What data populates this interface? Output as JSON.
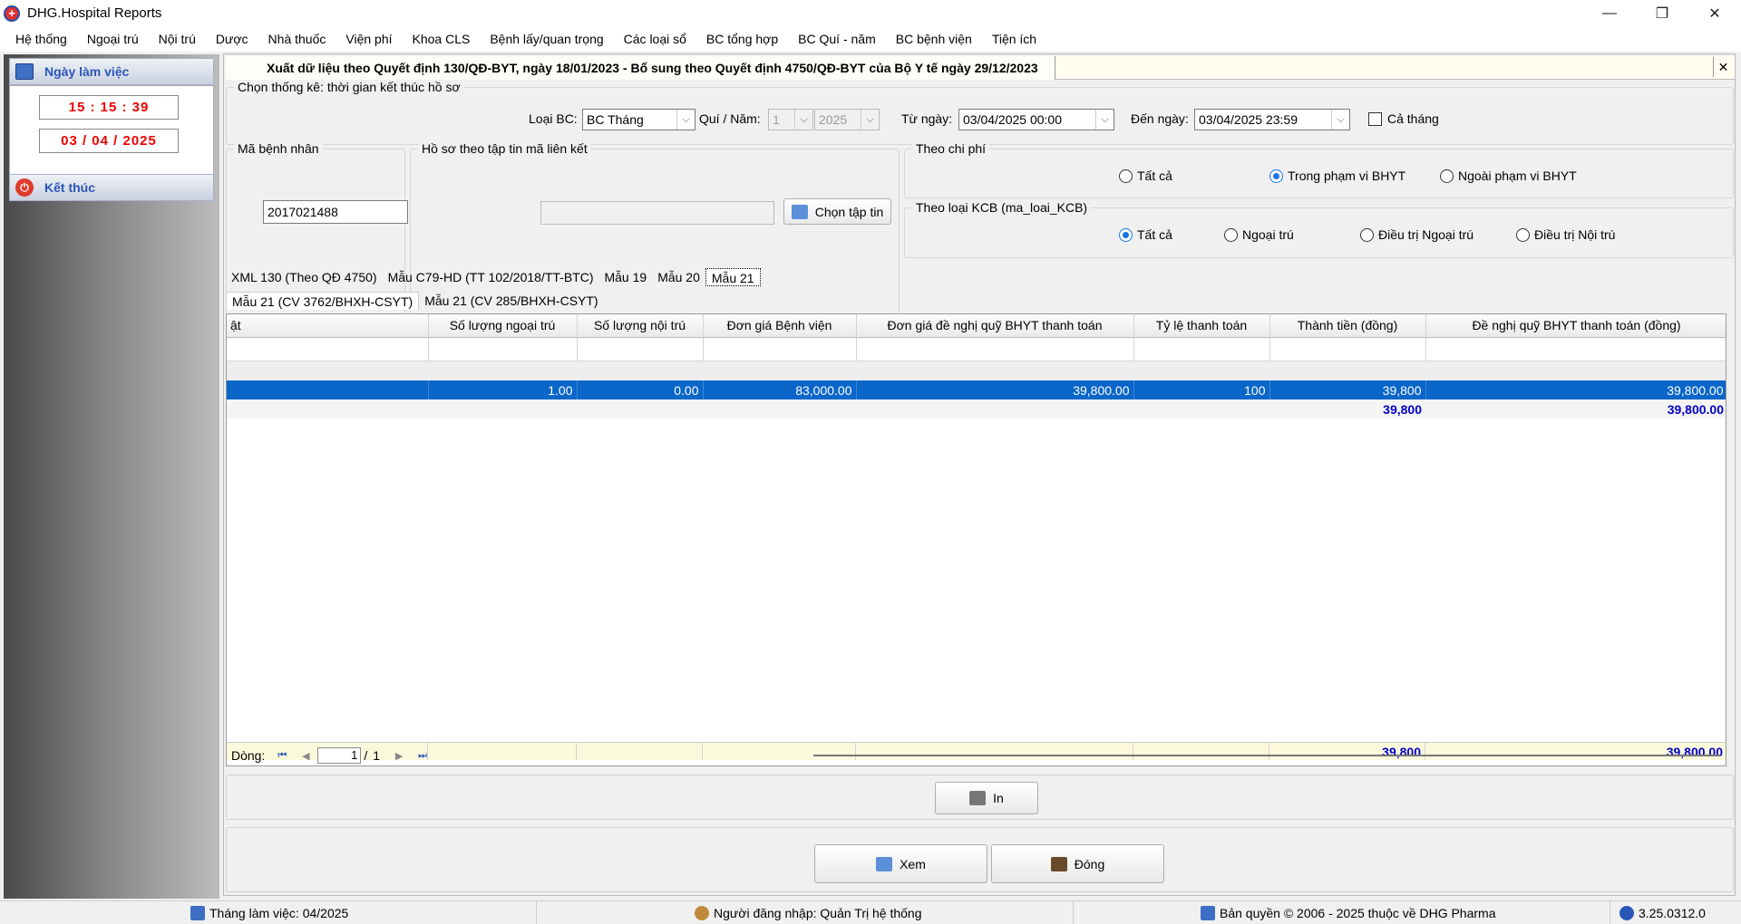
{
  "window": {
    "title": "DHG.Hospital Reports"
  },
  "menu": [
    "Hệ thống",
    "Ngoại trú",
    "Nội trú",
    "Dược",
    "Nhà thuốc",
    "Viện phí",
    "Khoa CLS",
    "Bệnh lấy/quan trọng",
    "Các loại sổ",
    "BC tổng hợp",
    "BC Quí - năm",
    "BC bệnh viện",
    "Tiện ích"
  ],
  "sidebar": {
    "workday_label": "Ngày làm việc",
    "time": "15 : 15 : 39",
    "date": "03 / 04 / 2025",
    "exit_label": "Kết thúc"
  },
  "doc": {
    "title": "Xuất dữ liệu theo Quyết định 130/QĐ-BYT, ngày 18/01/2023 - Bổ sung theo Quyết định 4750/QĐ-BYT của Bộ Y tế ngày 29/12/2023"
  },
  "filter": {
    "stat_label": "Chọn thống kê: thời gian kết thúc hồ sơ",
    "report_type_label": "Loại BC:",
    "report_type": "BC Tháng",
    "quarter_year_label": "Quí / Năm:",
    "quarter": "1",
    "year": "2025",
    "from_label": "Từ ngày:",
    "from": "03/04/2025 00:00",
    "to_label": "Đến ngày:",
    "to": "03/04/2025 23:59",
    "whole_month_label": "Cả tháng"
  },
  "patient": {
    "group_label": "Mã bệnh nhân",
    "id": "2017021488"
  },
  "file_group": {
    "label": "Hồ sơ theo tập tin mã liên kết",
    "choose_button": "Chọn tập tin"
  },
  "cost_group": {
    "label": "Theo chi phí",
    "options": [
      "Tất cả",
      "Trong phạm vi BHYT",
      "Ngoài phạm vi BHYT"
    ]
  },
  "kcb_group": {
    "label": "Theo loại KCB (ma_loai_KCB)",
    "options": [
      "Tất cả",
      "Ngoại trú",
      "Điều trị Ngoại trú",
      "Điều trị Nội trú"
    ]
  },
  "tabs_row1": [
    "XML 130 (Theo QĐ 4750)",
    "Mẫu C79-HD (TT 102/2018/TT-BTC)",
    "Mẫu 19",
    "Mẫu 20",
    "Mẫu 21"
  ],
  "tabs_row2": [
    "Mẫu 21 (CV 3762/BHXH-CSYT)",
    "Mẫu 21 (CV 285/BHXH-CSYT)"
  ],
  "grid": {
    "columns": [
      "ật",
      "Số lượng ngoại trú",
      "Số lượng nội trú",
      "Đơn giá Bệnh viện",
      "Đơn giá đề nghị quỹ BHYT thanh toán",
      "Tỷ lệ thanh toán",
      "Thành tiền (đồng)",
      "Đề nghị quỹ BHYT thanh toán (đồng)"
    ],
    "row": [
      "",
      "1.00",
      "0.00",
      "83,000.00",
      "39,800.00",
      "100",
      "39,800",
      "39,800.00"
    ],
    "subtotal": [
      "39,800",
      "39,800.00"
    ],
    "footer": [
      "39,800",
      "39,800.00"
    ]
  },
  "pager": {
    "label": "Dòng:",
    "page": "1",
    "sep": "/",
    "total": "1"
  },
  "buttons": {
    "print": "In",
    "view": "Xem",
    "close": "Đóng"
  },
  "status": {
    "month": "Tháng làm việc: 04/2025",
    "user": "Người đăng nhập: Quản Trị hệ thống",
    "copyright": "Bản quyền © 2006 - 2025 thuộc về DHG Pharma",
    "version": "3.25.0312.0"
  }
}
